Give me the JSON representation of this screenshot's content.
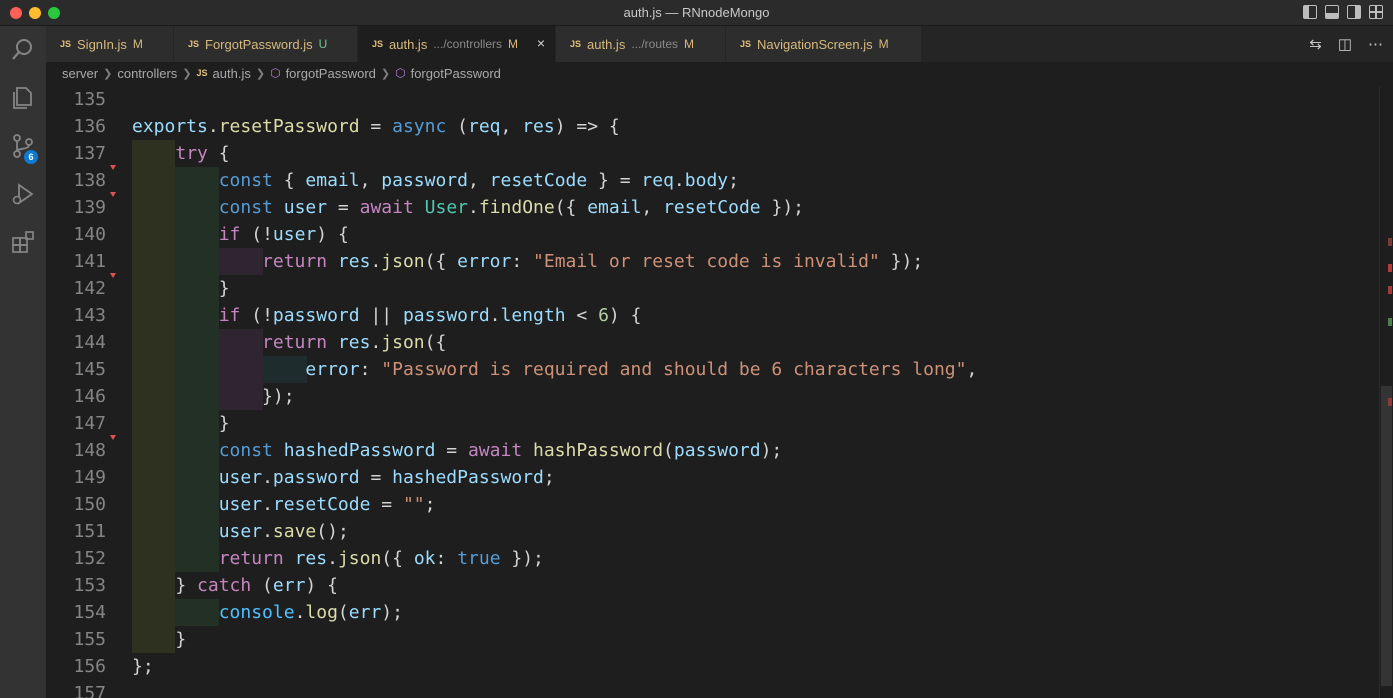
{
  "window": {
    "title": "auth.js — RNnodeMongo"
  },
  "activity_bar": {
    "items": [
      {
        "name": "search-icon"
      },
      {
        "name": "explorer-icon"
      },
      {
        "name": "source-control-icon",
        "badge": "6"
      },
      {
        "name": "run-debug-icon"
      },
      {
        "name": "extensions-icon"
      }
    ]
  },
  "tabs": [
    {
      "icon": "JS",
      "label": "SignIn.js",
      "desc": "",
      "status": "M"
    },
    {
      "icon": "JS",
      "label": "ForgotPassword.js",
      "desc": "",
      "status": "U"
    },
    {
      "icon": "JS",
      "label": "auth.js",
      "desc": ".../controllers",
      "status": "M",
      "active": true,
      "close": "×"
    },
    {
      "icon": "JS",
      "label": "auth.js",
      "desc": ".../routes",
      "status": "M"
    },
    {
      "icon": "JS",
      "label": "NavigationScreen.js",
      "desc": "",
      "status": "M"
    }
  ],
  "breadcrumb": {
    "items": [
      "server",
      "controllers",
      "auth.js",
      "forgotPassword",
      "forgotPassword"
    ]
  },
  "editor": {
    "lines": [
      {
        "n": "135",
        "code": ""
      },
      {
        "n": "136",
        "code": "exports.resetPassword = async (req, res) => {"
      },
      {
        "n": "137",
        "code": "  try {"
      },
      {
        "n": "138",
        "code": "    const { email, password, resetCode } = req.body;"
      },
      {
        "n": "139",
        "code": "    const user = await User.findOne({ email, resetCode });"
      },
      {
        "n": "140",
        "code": "    if (!user) {"
      },
      {
        "n": "141",
        "code": "      return res.json({ error: \"Email or reset code is invalid\" });"
      },
      {
        "n": "142",
        "code": "    }"
      },
      {
        "n": "143",
        "code": "    if (!password || password.length < 6) {"
      },
      {
        "n": "144",
        "code": "      return res.json({"
      },
      {
        "n": "145",
        "code": "        error: \"Password is required and should be 6 characters long\","
      },
      {
        "n": "146",
        "code": "      });"
      },
      {
        "n": "147",
        "code": "    }"
      },
      {
        "n": "148",
        "code": "    const hashedPassword = await hashPassword(password);"
      },
      {
        "n": "149",
        "code": "    user.password = hashedPassword;"
      },
      {
        "n": "150",
        "code": "    user.resetCode = \"\";"
      },
      {
        "n": "151",
        "code": "    user.save();"
      },
      {
        "n": "152",
        "code": "    return res.json({ ok: true });"
      },
      {
        "n": "153",
        "code": "  } catch (err) {"
      },
      {
        "n": "154",
        "code": "    console.log(err);"
      },
      {
        "n": "155",
        "code": "  }"
      },
      {
        "n": "156",
        "code": "};"
      },
      {
        "n": "157",
        "code": ""
      }
    ]
  },
  "colors": {
    "keyword": "#c586c0",
    "declaration": "#569cd6",
    "function": "#dcdcaa",
    "variable": "#9cdcfe",
    "string": "#ce9178",
    "number": "#b5cea8",
    "accent": "#0e7ad3"
  }
}
